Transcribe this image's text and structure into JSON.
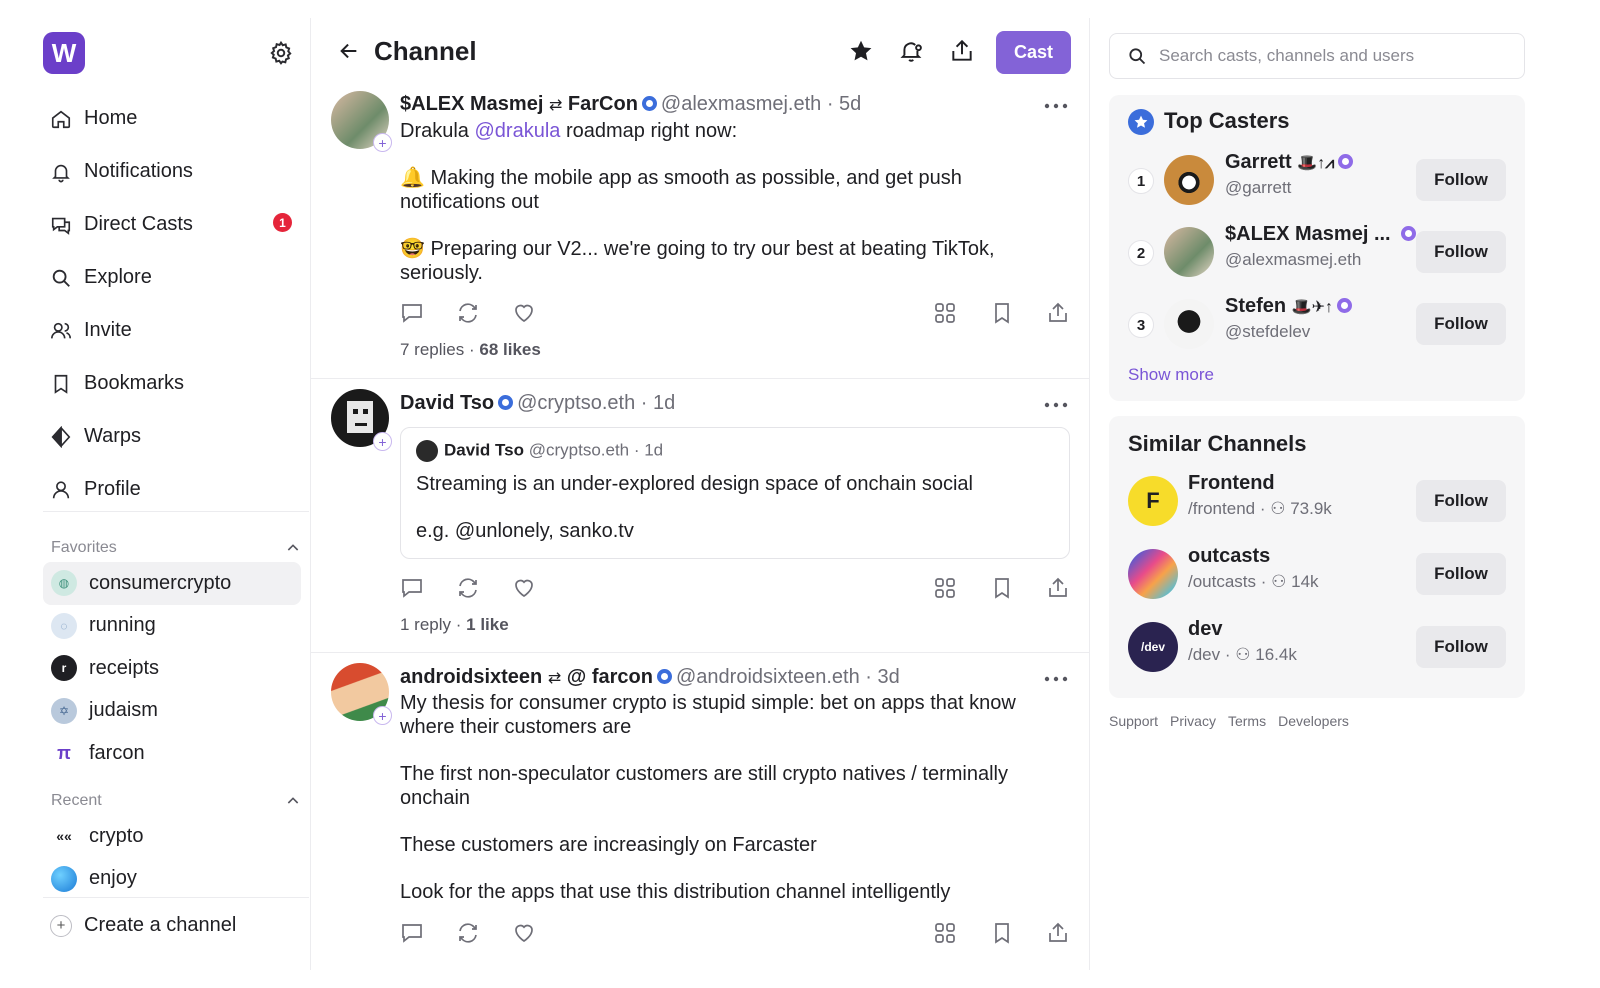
{
  "sidebar": {
    "logo_letter": "W",
    "nav": [
      {
        "label": "Home",
        "icon": "home-icon"
      },
      {
        "label": "Notifications",
        "icon": "bell-icon"
      },
      {
        "label": "Direct Casts",
        "icon": "chat-icon",
        "badge": "1"
      },
      {
        "label": "Explore",
        "icon": "search-icon"
      },
      {
        "label": "Invite",
        "icon": "users-icon"
      },
      {
        "label": "Bookmarks",
        "icon": "bookmark-icon"
      },
      {
        "label": "Warps",
        "icon": "warps-icon"
      },
      {
        "label": "Profile",
        "icon": "user-icon"
      }
    ],
    "favorites_label": "Favorites",
    "favorites": [
      {
        "label": "consumercrypto"
      },
      {
        "label": "running"
      },
      {
        "label": "receipts"
      },
      {
        "label": "judaism"
      },
      {
        "label": "farcon"
      }
    ],
    "recent_label": "Recent",
    "recent": [
      {
        "label": "crypto"
      },
      {
        "label": "enjoy"
      }
    ],
    "create_label": "Create a channel"
  },
  "header": {
    "title": "Channel",
    "cast_label": "Cast"
  },
  "posts": [
    {
      "name": "$ALEX Masmej",
      "name_suffix": "FarCon",
      "handle": "@alexmasmej.eth · 5d",
      "line1_pre": "Drakula ",
      "line1_mention": "@drakula",
      "line1_post": " roadmap right now:",
      "para1": "🔔 Making the mobile app as smooth as possible, and get push notifications out",
      "para2": "🤓 Preparing our V2... we're going to try our best at beating TikTok, seriously.",
      "replies": "7 replies",
      "likes": "68 likes"
    },
    {
      "name": "David Tso",
      "handle": "@cryptso.eth · 1d",
      "quote_name": "David Tso",
      "quote_handle": "@cryptso.eth · 1d",
      "quote_line1": "Streaming is an under-explored design space of onchain social",
      "quote_line2": "e.g. @unlonely, sanko.tv",
      "replies": "1 reply",
      "likes": "1 like"
    },
    {
      "name": "androidsixteen",
      "name_suffix": "@ farcon",
      "handle": "@androidsixteen.eth · 3d",
      "para1": "My thesis for consumer crypto is stupid simple: bet on apps that know where their customers are",
      "para2": "The first non-speculator customers are still crypto natives / terminally onchain",
      "para3": "These customers are increasingly on Farcaster",
      "para4": "Look for the apps that use this distribution channel intelligently"
    }
  ],
  "right": {
    "search_placeholder": "Search casts, channels and users",
    "top_casters_title": "Top Casters",
    "casters": [
      {
        "rank": "1",
        "name": "Garrett",
        "emojis": "🎩↑⩘",
        "handle": "@garrett",
        "follow": "Follow"
      },
      {
        "rank": "2",
        "name": "$ALEX Masmej ...",
        "emojis": "",
        "handle": "@alexmasmej.eth",
        "follow": "Follow"
      },
      {
        "rank": "3",
        "name": "Stefen",
        "emojis": "🎩✈↑",
        "handle": "@stefdelev",
        "follow": "Follow"
      }
    ],
    "show_more": "Show more",
    "similar_title": "Similar Channels",
    "channels": [
      {
        "name": "Frontend",
        "path": "/frontend",
        "members": "73.9k",
        "follow": "Follow"
      },
      {
        "name": "outcasts",
        "path": "/outcasts",
        "members": "14k",
        "follow": "Follow"
      },
      {
        "name": "dev",
        "path": "/dev",
        "members": "16.4k",
        "follow": "Follow",
        "avatar_text": "/dev"
      }
    ],
    "footer": [
      "Support",
      "Privacy",
      "Terms",
      "Developers"
    ]
  },
  "colors": {
    "accent": "#8363d7",
    "logo": "#6b3fc9",
    "badge": "#e5253a",
    "verified": "#3b6ddb"
  }
}
